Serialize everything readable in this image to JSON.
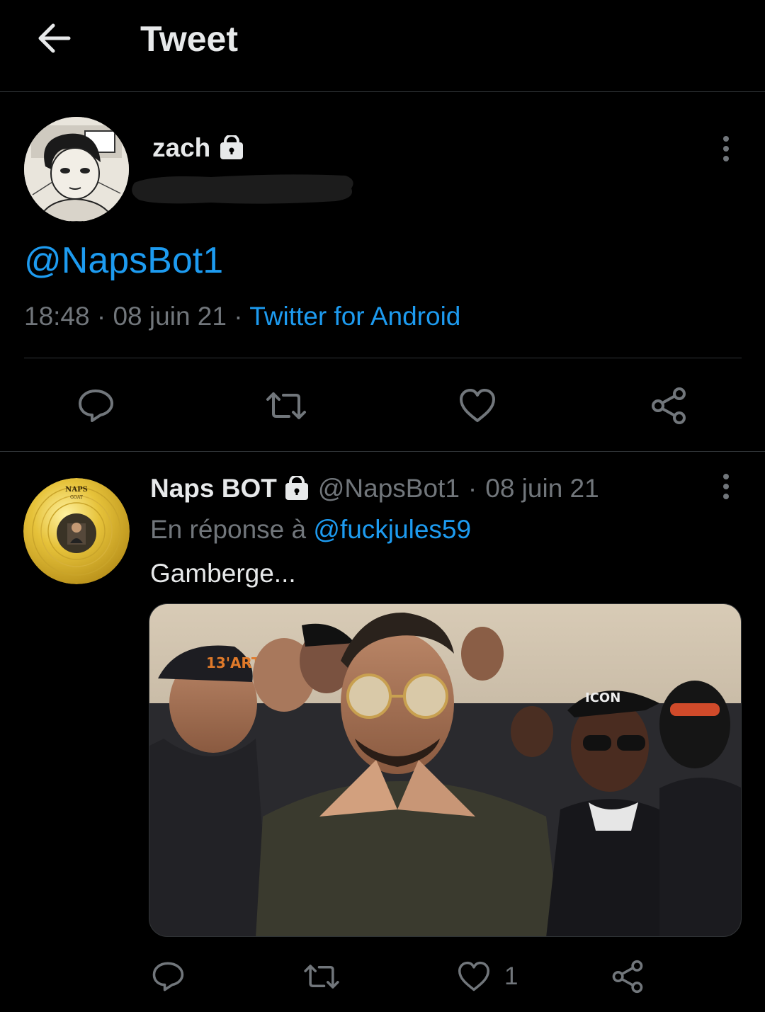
{
  "header": {
    "title": "Tweet",
    "back_icon": "arrow-left-icon"
  },
  "main_tweet": {
    "author_name": "zach",
    "protected_icon": "lock-icon",
    "text": "@NapsBot1",
    "time": "18:48",
    "date": "08 juin 21",
    "source": "Twitter for Android",
    "separator": "·",
    "actions": [
      "reply-icon",
      "retweet-icon",
      "like-icon",
      "share-icon"
    ]
  },
  "reply_tweet": {
    "author_name": "Naps BOT",
    "handle": "@NapsBot1",
    "separator": "·",
    "date": "08 juin 21",
    "reply_prefix": "En réponse à",
    "reply_mention": "@fuckjules59",
    "text": "Gamberge...",
    "like_count": "1",
    "avatar_label": "NAPS",
    "avatar_sublabel": "GOAT",
    "media_caps": [
      "13'ART",
      "ICON"
    ],
    "actions": [
      "reply-icon",
      "retweet-icon",
      "like-icon",
      "share-icon"
    ]
  },
  "colors": {
    "background": "#000000",
    "text_primary": "#e7e9ea",
    "text_secondary": "#71767b",
    "link": "#1d9bf0",
    "divider": "#2f3336"
  }
}
